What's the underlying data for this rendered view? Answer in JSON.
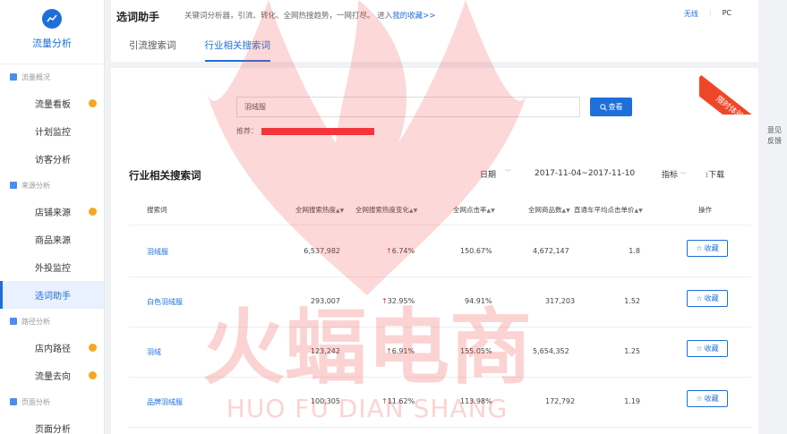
{
  "sidebar": {
    "brand": "流量分析",
    "sections": [
      {
        "title": "流量概况",
        "items": [
          {
            "label": "流量看板",
            "dot": true
          },
          {
            "label": "计划监控",
            "dot": false
          },
          {
            "label": "访客分析",
            "dot": false
          }
        ]
      },
      {
        "title": "来源分析",
        "items": [
          {
            "label": "店铺来源",
            "dot": true
          },
          {
            "label": "商品来源",
            "dot": false
          },
          {
            "label": "外投监控",
            "dot": false
          },
          {
            "label": "选词助手",
            "dot": false,
            "active": true
          }
        ]
      },
      {
        "title": "路径分析",
        "items": [
          {
            "label": "店内路径",
            "dot": true
          },
          {
            "label": "流量去向",
            "dot": true
          }
        ]
      },
      {
        "title": "页面分析",
        "items": [
          {
            "label": "页面分析",
            "dot": false
          }
        ]
      }
    ]
  },
  "header": {
    "title": "选词助手",
    "desc": "关键词分析器，引流、转化、全网热搜趋势，一网打尽。 进入",
    "link": "我的收藏>>",
    "right": [
      "无线",
      "PC"
    ],
    "tabs": [
      "引流搜索词",
      "行业相关搜索词"
    ]
  },
  "search": {
    "value": "羽绒服",
    "button": "查看",
    "rec_label": "推荐："
  },
  "ribbon": "限时体验",
  "section": {
    "title": "行业相关搜索词",
    "date_label": "日期",
    "date_range": "2017-11-04~2017-11-10",
    "metric_label": "指标",
    "download": "下载"
  },
  "table": {
    "headers": [
      "搜索词",
      "全网搜索热度",
      "全网搜索热度变化",
      "全网点击率",
      "全网商品数",
      "直通车平均点击单价",
      "操作"
    ],
    "rows": [
      {
        "kw": "羽绒服",
        "heat": "6,537,982",
        "change": "6.74%",
        "ctr": "150.67%",
        "goods": "4,672,147",
        "cpc": "1.8"
      },
      {
        "kw": "白色羽绒服",
        "heat": "293,007",
        "change": "32.95%",
        "ctr": "94.91%",
        "goods": "317,203",
        "cpc": "1.52"
      },
      {
        "kw": "羽绒",
        "heat": "123,242",
        "change": "6.91%",
        "ctr": "155.05%",
        "goods": "5,654,352",
        "cpc": "1.25"
      },
      {
        "kw": "品牌羽绒服",
        "heat": "100,305",
        "change": "11.62%",
        "ctr": "113.98%",
        "goods": "172,792",
        "cpc": "1.19"
      }
    ],
    "fav_label": "收藏"
  },
  "feedback": [
    "意见",
    "反馈"
  ],
  "watermark": {
    "cn": "火蝠电商",
    "en": "HUO FU DIAN SHANG"
  }
}
